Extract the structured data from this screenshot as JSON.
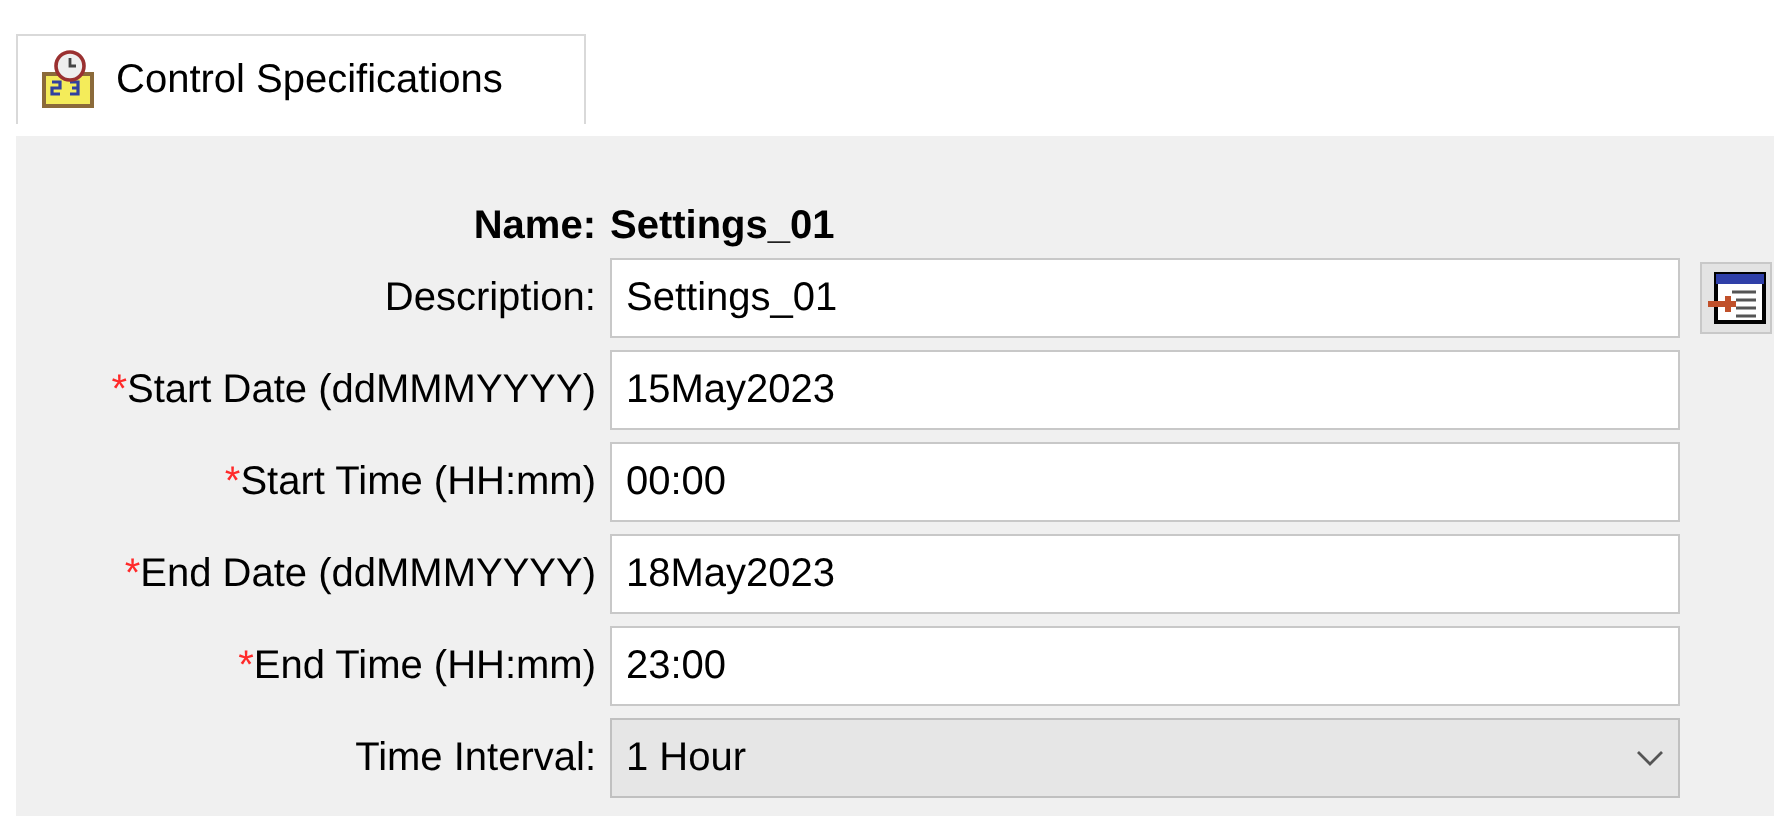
{
  "tab": {
    "label": "Control Specifications",
    "selected": true
  },
  "name": {
    "label": "Name:",
    "value": "Settings_01"
  },
  "fields": [
    {
      "kind": "text",
      "label": "Description:",
      "value": "Settings_01",
      "has_button": true
    },
    {
      "kind": "text",
      "marker": "*",
      "label": "Start Date (ddMMMYYYY)",
      "value": "15May2023",
      "has_button": false
    },
    {
      "kind": "text",
      "marker": "*",
      "label": "Start Time (HH:mm)",
      "value": "00:00",
      "has_button": false
    },
    {
      "kind": "text",
      "marker": "*",
      "label": "End Date (ddMMMYYYY)",
      "value": "18May2023",
      "has_button": false
    },
    {
      "kind": "text",
      "marker": "*",
      "label": "End Time (HH:mm)",
      "value": "23:00",
      "has_button": false
    },
    {
      "kind": "dropdown",
      "label": "Time Interval:",
      "value": "1 Hour",
      "has_button": false
    }
  ]
}
